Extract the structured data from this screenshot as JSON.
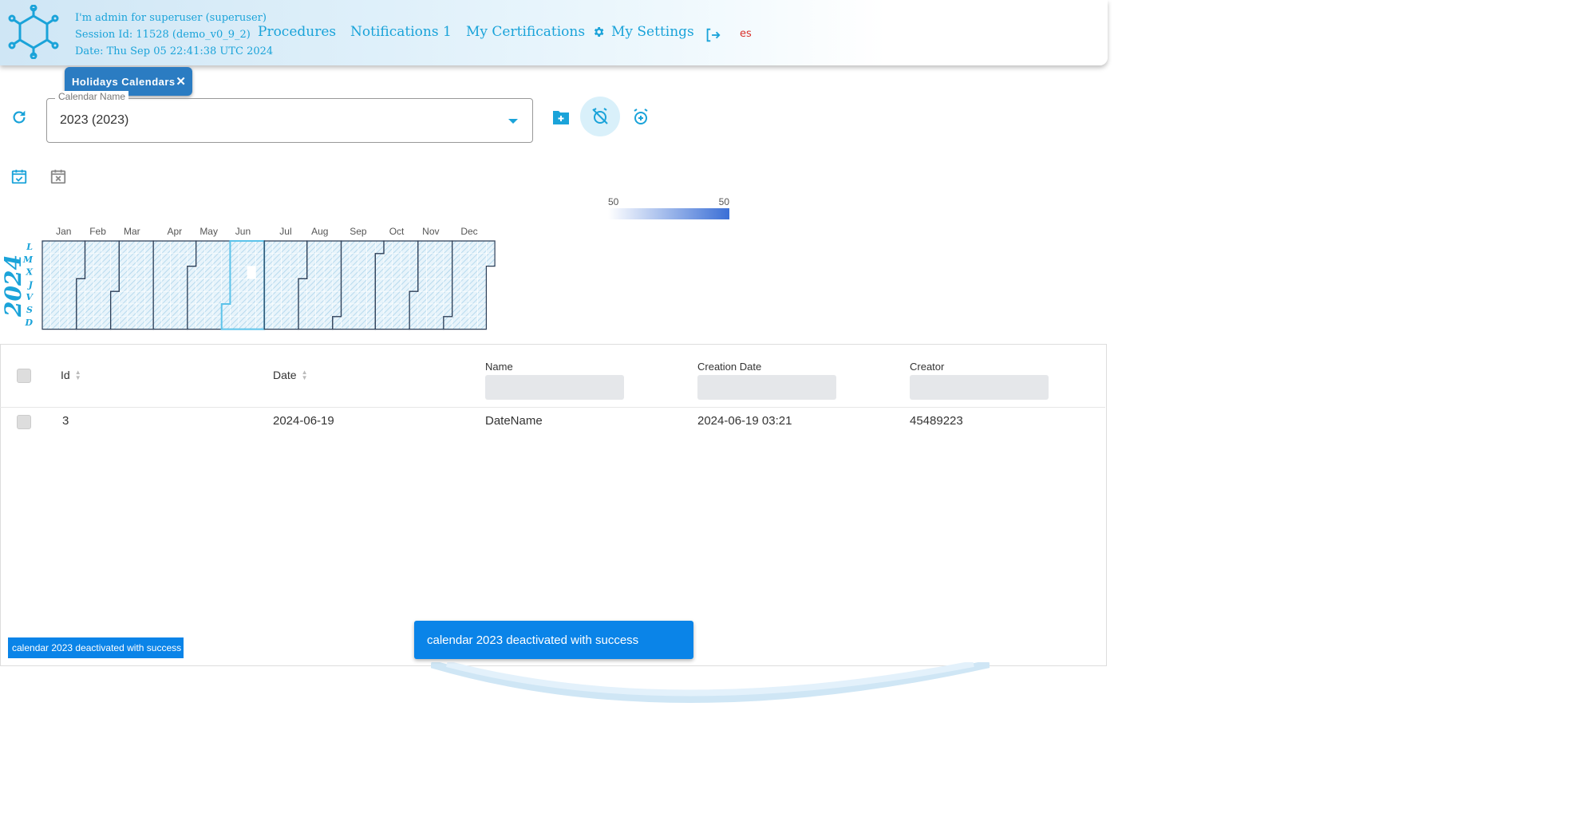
{
  "header": {
    "session_user": "I'm admin for superuser (superuser)",
    "session_id": "Session Id: 11528 (demo_v0_9_2)",
    "session_date": "Date: Thu Sep 05 22:41:38 UTC 2024",
    "nav": {
      "procedures": "Procedures",
      "notifications": "Notifications 1",
      "certifications": "My Certifications",
      "settings": "My Settings"
    },
    "language": "es"
  },
  "tab": {
    "label": "Holidays Calendars"
  },
  "calendar_select": {
    "label": "Calendar Name",
    "value": "2023 (2023)"
  },
  "heatmap": {
    "year": "2024",
    "weekdays": [
      "L",
      "M",
      "X",
      "J",
      "V",
      "S",
      "D"
    ],
    "months": [
      "Jan",
      "Feb",
      "Mar",
      "Apr",
      "May",
      "Jun",
      "Jul",
      "Aug",
      "Sep",
      "Oct",
      "Nov",
      "Dec"
    ],
    "legend_min": "50",
    "legend_max": "50",
    "highlight_color": "#3b6fd6"
  },
  "table": {
    "columns": {
      "id": "Id",
      "date": "Date",
      "name": "Name",
      "creation_date": "Creation Date",
      "creator": "Creator"
    },
    "rows": [
      {
        "id": "3",
        "date": "2024-06-19",
        "name": "DateName",
        "creation_date": "2024-06-19 03:21",
        "creator": "45489223"
      }
    ]
  },
  "toasts": {
    "small": "calendar 2023 deactivated with success",
    "main": "calendar 2023 deactivated with success"
  },
  "colors": {
    "accent": "#1aa3d9",
    "chip": "#2b7cc2",
    "toast": "#0a84e8"
  }
}
